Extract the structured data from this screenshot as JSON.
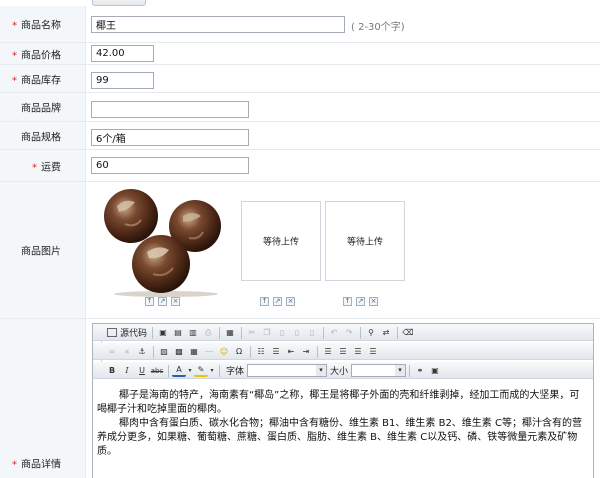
{
  "form": {
    "name": {
      "label": "商品名称",
      "required": "*",
      "value": "椰王",
      "hint": "( 2-30个字)"
    },
    "price": {
      "label": "商品价格",
      "required": "*",
      "value": "42.00"
    },
    "stock": {
      "label": "商品库存",
      "required": "*",
      "value": "99"
    },
    "brand": {
      "label": "商品品牌",
      "value": ""
    },
    "spec": {
      "label": "商品规格",
      "value": "6个/箱"
    },
    "shipping": {
      "label": "运费",
      "required": "*",
      "value": "60"
    },
    "images": {
      "label": "商品图片",
      "slots": [
        "等待上传",
        "等待上传"
      ]
    },
    "detail": {
      "label": "商品详情",
      "required": "*"
    }
  },
  "editor": {
    "source_label": "源代码",
    "font_label": "字体",
    "size_label": "大小",
    "content": [
      "椰子是海南的特产，海南素有“椰岛”之称，椰王是将椰子外面的壳和纤维剥掉，经加工而成的大坚果，可喝椰子汁和吃掉里面的椰肉。",
      "椰肉中含有蛋白质、碳水化合物；椰油中含有糖份、维生素 B1、维生素 B2、维生素 C等；椰汁含有的营养成分更多，如果糖、葡萄糖、蔗糖、蛋白质、脂肪、维生素 B、维生素 C以及钙、磷、铁等微量元素及矿物质。"
    ]
  },
  "colors": {
    "required": "#e02020",
    "label_bg": "#f4f7fa",
    "border": "#a5acb5"
  }
}
